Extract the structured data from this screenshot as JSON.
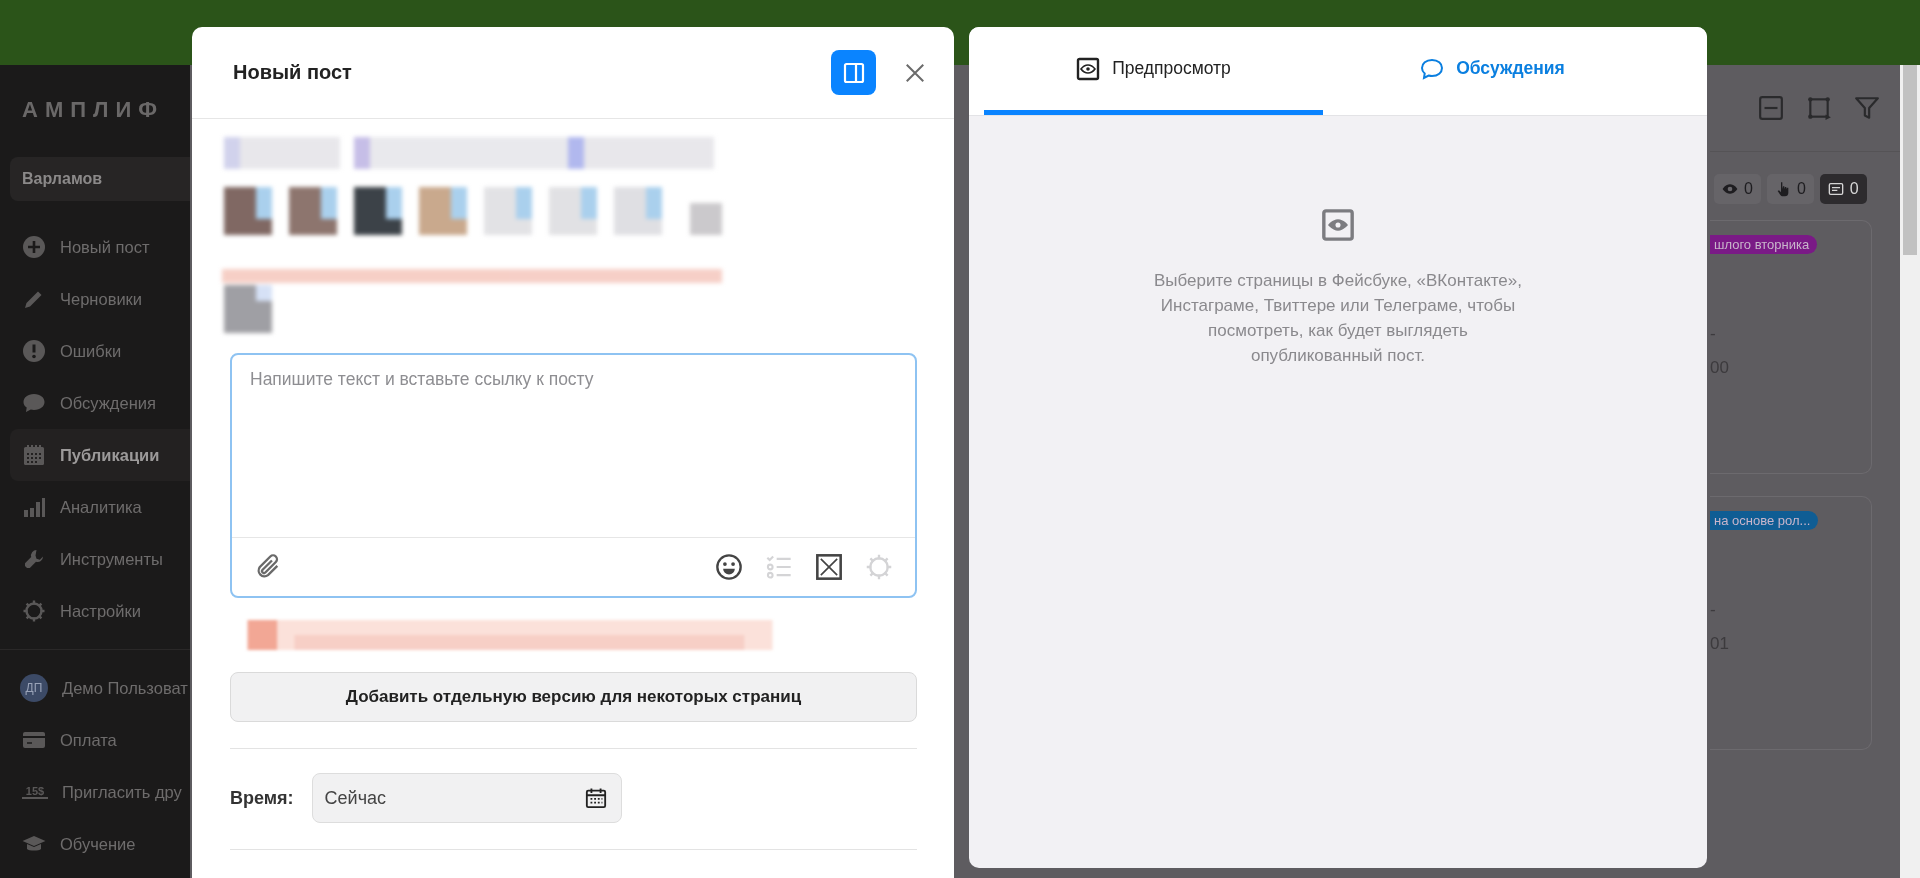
{
  "sidebar": {
    "logo": "АМПЛИФ",
    "account": "Варламов",
    "items": [
      {
        "label": "Новый пост",
        "selected": false
      },
      {
        "label": "Черновики",
        "selected": false
      },
      {
        "label": "Ошибки",
        "selected": false
      },
      {
        "label": "Обсуждения",
        "selected": false
      },
      {
        "label": "Публикации",
        "selected": true
      },
      {
        "label": "Аналитика",
        "selected": false
      },
      {
        "label": "Инструменты",
        "selected": false
      },
      {
        "label": "Настройки",
        "selected": false
      }
    ],
    "footer_items": [
      {
        "kind": "avatar",
        "avatar": "ДП",
        "label": "Демо Пользоват"
      },
      {
        "kind": "card",
        "label": "Оплата"
      },
      {
        "kind": "invite",
        "badge": "15$",
        "label": "Пригласить дру"
      },
      {
        "kind": "course",
        "label": "Обучение"
      }
    ]
  },
  "background": {
    "counters": [
      {
        "kind": "views",
        "value": "0",
        "selected": false
      },
      {
        "kind": "clicks",
        "value": "0",
        "selected": false
      },
      {
        "kind": "comments",
        "value": "0",
        "selected": true
      }
    ],
    "cards": [
      {
        "tag": "шлого вторника",
        "color": "#7a1a86",
        "line_1": "-",
        "line_2": "00"
      },
      {
        "tag": "на основе рол...",
        "color": "#0f5d94",
        "line_1": "-",
        "line_2": "01"
      }
    ]
  },
  "editor": {
    "title": "Новый пост",
    "preview_on": true,
    "placeholder": "Напишите текст и вставьте ссылку к посту",
    "tools": [
      {
        "kind": "emoji",
        "disabled": false
      },
      {
        "kind": "checklist",
        "disabled": true
      },
      {
        "kind": "media",
        "disabled": false
      },
      {
        "kind": "settings",
        "disabled": true
      }
    ],
    "version_button": "Добавить отдельную версию для некоторых страниц",
    "time_label": "Время:",
    "time_value": "Сейчас"
  },
  "preview": {
    "tabs": [
      {
        "kind": "preview",
        "label": "Предпросмотр",
        "selected": true
      },
      {
        "kind": "discussion",
        "label": "Обсуждения",
        "selected": false
      }
    ],
    "message": "Выберите страницы в Фейсбуке, «ВКонтакте», Инстаграме, Твиттере или Телеграме, чтобы посмотреть, как будет выглядеть опубликованный пост."
  }
}
